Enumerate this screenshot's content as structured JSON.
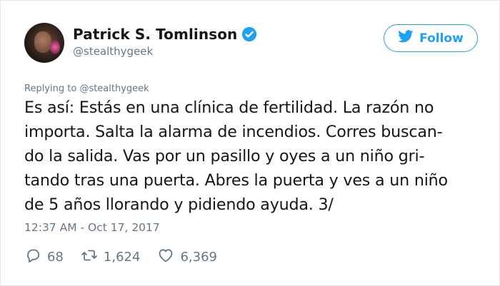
{
  "author": {
    "name": "Patrick S. Tomlinson",
    "handle": "@stealthygeek"
  },
  "follow_button": {
    "label": "Follow"
  },
  "reply_context": {
    "prefix": "Replying to",
    "handle": "@stealthygeek"
  },
  "tweet": {
    "lines": [
      "Es así: Estás en una clínica de fertilidad. La razón no",
      "importa. Salta la alarma de incendios. Corres buscan-",
      "do la salida. Vas por un pasillo y oyes a un niño gri-",
      "tando tras una puerta. Abres la puerta y ves a un niño",
      "de 5 años llorando y pidiendo ayuda. 3/"
    ],
    "timestamp": "12:37 AM - Oct 17, 2017"
  },
  "actions": {
    "replies": "68",
    "retweets": "1,624",
    "likes": "6,369"
  },
  "icons": {
    "verified": "verified-badge-icon",
    "bird": "twitter-bird-icon",
    "reply": "reply-icon",
    "retweet": "retweet-icon",
    "like": "heart-icon"
  },
  "colors": {
    "accent": "#1da1f2",
    "muted": "#657786",
    "text": "#14171a"
  }
}
